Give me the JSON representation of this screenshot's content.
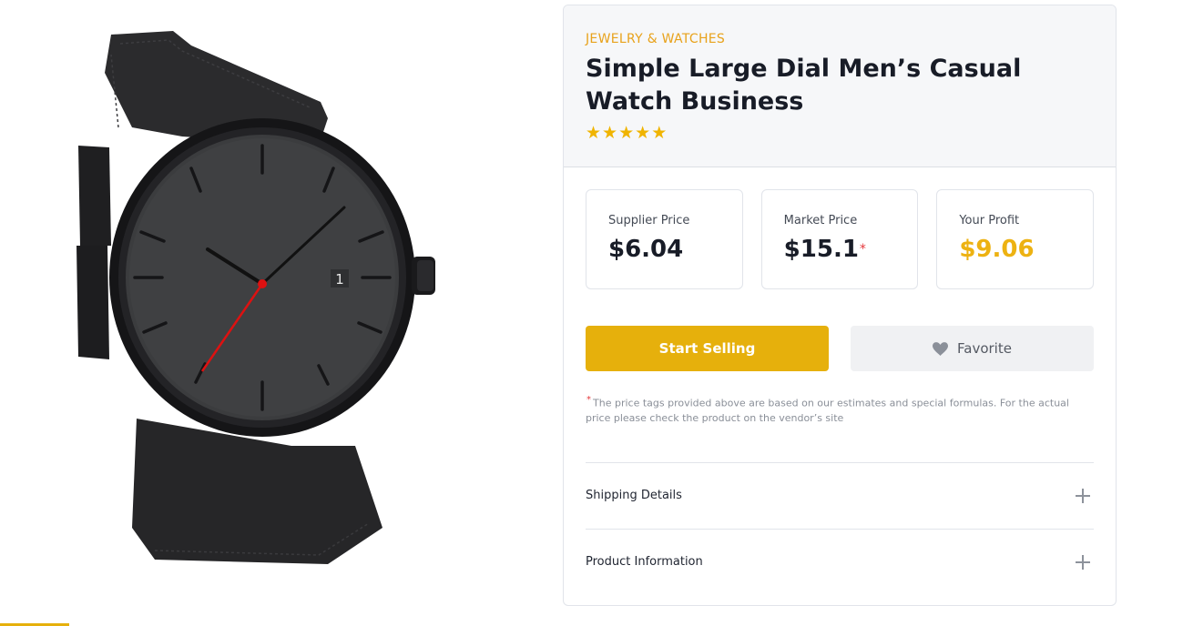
{
  "product": {
    "category": "JEWELRY & WATCHES",
    "title": "Simple Large Dial Men’s Casual Watch Business",
    "rating_stars": 5,
    "star_glyph": "★",
    "dial_date": "1",
    "image_icon": "watch-product-image"
  },
  "prices": {
    "supplier": {
      "label": "Supplier Price",
      "value": "$6.04"
    },
    "market": {
      "label": "Market Price",
      "value": "$15.1",
      "marker": "*"
    },
    "profit": {
      "label": "Your Profit",
      "value": "$9.06"
    }
  },
  "actions": {
    "start_selling": "Start Selling",
    "favorite": "Favorite",
    "favorite_icon": "heart-icon"
  },
  "note": {
    "marker": "*",
    "text": "The price tags provided above are based on our estimates and special formulas. For the actual price please check the product on the vendor’s site"
  },
  "accordion": {
    "shipping": "Shipping Details",
    "product_info": "Product Information",
    "expand_icon": "plus-icon"
  },
  "colors": {
    "accent": "#e6b00c",
    "category": "#e8a21b",
    "profit": "#edb212",
    "star": "#f0b400",
    "asterisk": "#e5383b"
  }
}
